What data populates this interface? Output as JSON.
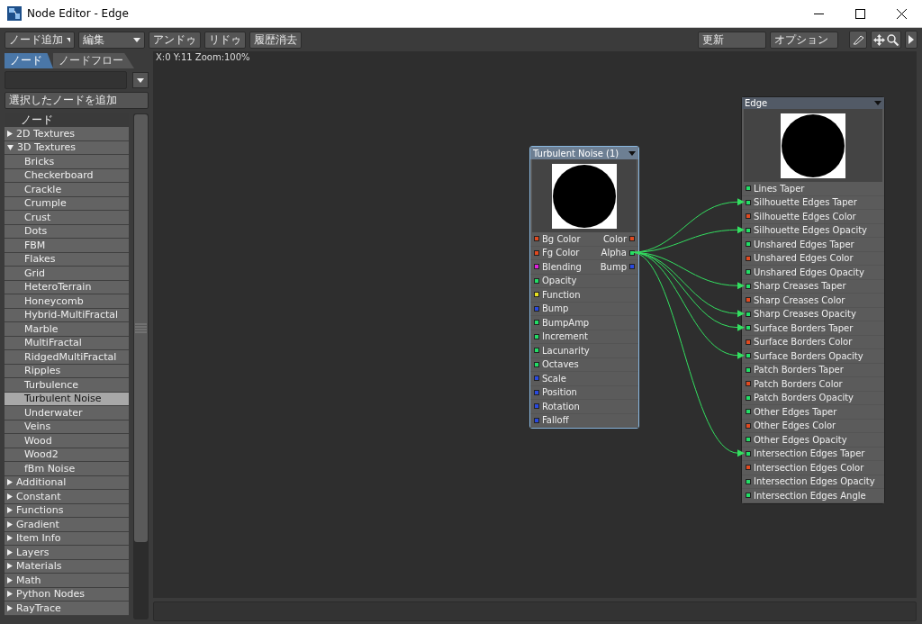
{
  "window": {
    "title": "Node Editor - Edge"
  },
  "toolbar": {
    "left": [
      {
        "kind": "dropdown",
        "label": "ノード追加"
      },
      {
        "kind": "dropdown",
        "label": "編集"
      },
      {
        "kind": "button",
        "label": "アンドゥ"
      },
      {
        "kind": "button",
        "label": "リドゥ"
      },
      {
        "kind": "button",
        "label": "履歴消去"
      }
    ],
    "right": [
      {
        "kind": "button",
        "label": "更新"
      },
      {
        "kind": "button",
        "label": "オプション"
      }
    ]
  },
  "sidebar": {
    "tabs": [
      {
        "label": "ノード",
        "selected": true
      },
      {
        "label": "ノードフロー",
        "selected": false
      }
    ],
    "add_button": "選択したノードを追加",
    "list_header": "ノード",
    "items": [
      {
        "label": "2D Textures",
        "expanded": false,
        "selected": false
      },
      {
        "label": "3D Textures",
        "expanded": true,
        "selected": false,
        "children": [
          {
            "label": "Bricks",
            "selected": false
          },
          {
            "label": "Checkerboard",
            "selected": false
          },
          {
            "label": "Crackle",
            "selected": false
          },
          {
            "label": "Crumple",
            "selected": false
          },
          {
            "label": "Crust",
            "selected": false
          },
          {
            "label": "Dots",
            "selected": false
          },
          {
            "label": "FBM",
            "selected": false
          },
          {
            "label": "Flakes",
            "selected": false
          },
          {
            "label": "Grid",
            "selected": false
          },
          {
            "label": "HeteroTerrain",
            "selected": false
          },
          {
            "label": "Honeycomb",
            "selected": false
          },
          {
            "label": "Hybrid-MultiFractal",
            "selected": false
          },
          {
            "label": "Marble",
            "selected": false
          },
          {
            "label": "MultiFractal",
            "selected": false
          },
          {
            "label": "RidgedMultiFractal",
            "selected": false
          },
          {
            "label": "Ripples",
            "selected": false
          },
          {
            "label": "Turbulence",
            "selected": false
          },
          {
            "label": "Turbulent Noise",
            "selected": true
          },
          {
            "label": "Underwater",
            "selected": false
          },
          {
            "label": "Veins",
            "selected": false
          },
          {
            "label": "Wood",
            "selected": false
          },
          {
            "label": "Wood2",
            "selected": false
          },
          {
            "label": "fBm Noise",
            "selected": false
          }
        ]
      },
      {
        "label": "Additional",
        "expanded": false,
        "selected": false
      },
      {
        "label": "Constant",
        "expanded": false,
        "selected": false
      },
      {
        "label": "Functions",
        "expanded": false,
        "selected": false
      },
      {
        "label": "Gradient",
        "expanded": false,
        "selected": false
      },
      {
        "label": "Item Info",
        "expanded": false,
        "selected": false
      },
      {
        "label": "Layers",
        "expanded": false,
        "selected": false
      },
      {
        "label": "Materials",
        "expanded": false,
        "selected": false
      },
      {
        "label": "Math",
        "expanded": false,
        "selected": false
      },
      {
        "label": "Python Nodes",
        "expanded": false,
        "selected": false
      },
      {
        "label": "RayTrace",
        "expanded": false,
        "selected": false
      }
    ]
  },
  "canvas": {
    "status": "X:0 Y:11 Zoom:100%",
    "nodes": [
      {
        "title": "Turbulent Noise (1)",
        "selected": true,
        "outputs": [
          {
            "label": "Color",
            "color": "#e04a20",
            "wired": false
          },
          {
            "label": "Alpha",
            "color": "#22dd66",
            "wired": true
          },
          {
            "label": "Bump",
            "color": "#2a4ae0",
            "wired": false
          }
        ],
        "inputs": [
          {
            "label": "Bg Color",
            "color": "#e04a20"
          },
          {
            "label": "Fg Color",
            "color": "#e04a20"
          },
          {
            "label": "Blending",
            "color": "#e020e0"
          },
          {
            "label": "Opacity",
            "color": "#22dd66"
          },
          {
            "label": "Function",
            "color": "#e8e020"
          },
          {
            "label": "Bump",
            "color": "#2a4ae0"
          },
          {
            "label": "BumpAmp",
            "color": "#22dd66"
          },
          {
            "label": "Increment",
            "color": "#22dd66"
          },
          {
            "label": "Lacunarity",
            "color": "#22dd66"
          },
          {
            "label": "Octaves",
            "color": "#22dd66"
          },
          {
            "label": "Scale",
            "color": "#2a4ae0"
          },
          {
            "label": "Position",
            "color": "#2a4ae0"
          },
          {
            "label": "Rotation",
            "color": "#2a4ae0"
          },
          {
            "label": "Falloff",
            "color": "#2a4ae0"
          }
        ]
      },
      {
        "title": "Edge",
        "selected": false,
        "inputs": [
          {
            "label": "Lines Taper",
            "color": "#22dd66",
            "connected": false
          },
          {
            "label": "Silhouette Edges Taper",
            "color": "#22dd66",
            "connected": true
          },
          {
            "label": "Silhouette Edges Color",
            "color": "#e04a20",
            "connected": false
          },
          {
            "label": "Silhouette Edges Opacity",
            "color": "#22dd66",
            "connected": true
          },
          {
            "label": "Unshared Edges Taper",
            "color": "#22dd66",
            "connected": false
          },
          {
            "label": "Unshared Edges Color",
            "color": "#e04a20",
            "connected": false
          },
          {
            "label": "Unshared Edges Opacity",
            "color": "#22dd66",
            "connected": false
          },
          {
            "label": "Sharp Creases Taper",
            "color": "#22dd66",
            "connected": true
          },
          {
            "label": "Sharp Creases Color",
            "color": "#e04a20",
            "connected": false
          },
          {
            "label": "Sharp Creases Opacity",
            "color": "#22dd66",
            "connected": true
          },
          {
            "label": "Surface Borders Taper",
            "color": "#22dd66",
            "connected": true
          },
          {
            "label": "Surface Borders Color",
            "color": "#e04a20",
            "connected": false
          },
          {
            "label": "Surface Borders Opacity",
            "color": "#22dd66",
            "connected": true
          },
          {
            "label": "Patch Borders Taper",
            "color": "#22dd66",
            "connected": false
          },
          {
            "label": "Patch Borders Color",
            "color": "#e04a20",
            "connected": false
          },
          {
            "label": "Patch Borders Opacity",
            "color": "#22dd66",
            "connected": false
          },
          {
            "label": "Other Edges Taper",
            "color": "#22dd66",
            "connected": false
          },
          {
            "label": "Other Edges Color",
            "color": "#e04a20",
            "connected": false
          },
          {
            "label": "Other Edges Opacity",
            "color": "#22dd66",
            "connected": false
          },
          {
            "label": "Intersection Edges Taper",
            "color": "#22dd66",
            "connected": true
          },
          {
            "label": "Intersection Edges Color",
            "color": "#e04a20",
            "connected": false
          },
          {
            "label": "Intersection Edges Opacity",
            "color": "#22dd66",
            "connected": false
          },
          {
            "label": "Intersection Edges Angle",
            "color": "#22dd66",
            "connected": false
          }
        ]
      }
    ]
  }
}
